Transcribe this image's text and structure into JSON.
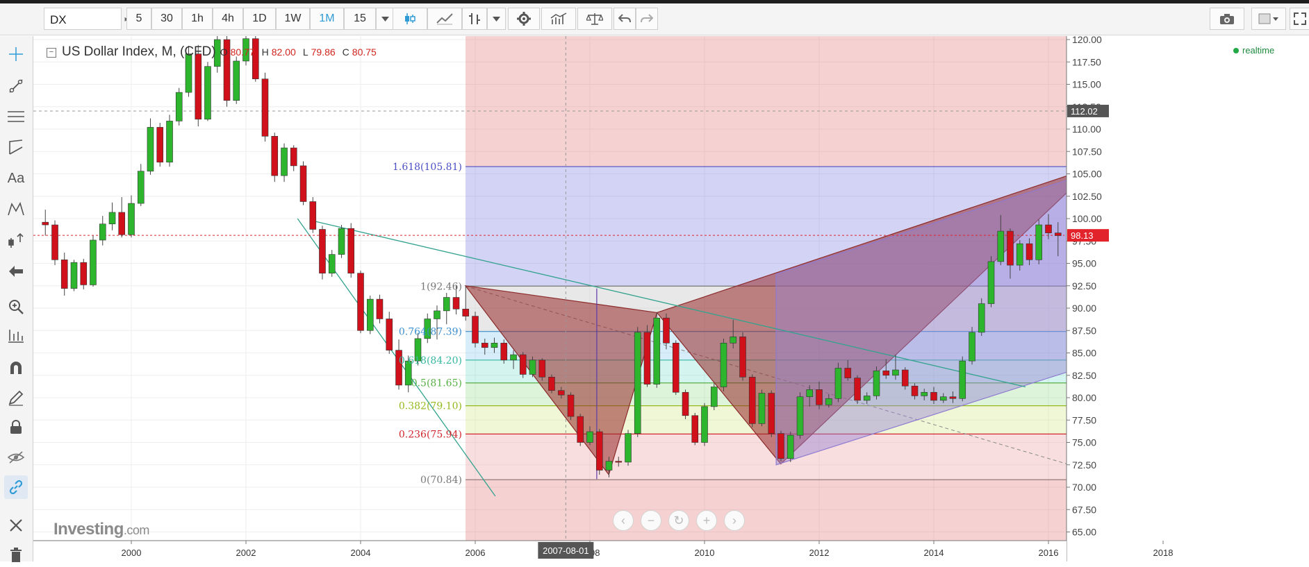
{
  "toolbar": {
    "symbol": "DX",
    "intervals": [
      "5",
      "30",
      "1h",
      "4h",
      "1D",
      "1W",
      "1M",
      "15"
    ],
    "active_interval": "1M"
  },
  "legend": {
    "title": "US Dollar Index, M, (CFD)",
    "o_label": "O",
    "o": "80.77",
    "h_label": "H",
    "h": "82.00",
    "l_label": "L",
    "l": "79.86",
    "c_label": "C",
    "c": "80.75"
  },
  "status": {
    "realtime": "realtime"
  },
  "watermark": {
    "brand": "Investing",
    "tld": ".com"
  },
  "crosshair_date": "2007-08-01",
  "colors": {
    "up": "#2db52d",
    "down": "#d0101a",
    "fib_618": "#4b4fc4",
    "fib_1": "#777777",
    "fib_764": "#3b8fd0",
    "fib_0618": "#35b7a0",
    "fib_05": "#56b045",
    "fib_0382": "#93b91d",
    "fib_0236": "#d0252c",
    "fib_0": "#8a6f6f"
  },
  "chart_data": {
    "type": "candlestick",
    "symbol": "US Dollar Index",
    "interval": "M",
    "x_ticks": [
      "2000",
      "2002",
      "2004",
      "2006",
      "2008",
      "2010",
      "2012",
      "2014",
      "2016",
      "2018"
    ],
    "y_ticks": [
      "120.00",
      "117.50",
      "115.00",
      "112.50",
      "110.00",
      "107.50",
      "105.00",
      "102.50",
      "100.00",
      "97.50",
      "95.00",
      "92.50",
      "90.00",
      "87.50",
      "85.00",
      "82.50",
      "80.00",
      "77.50",
      "75.00",
      "72.50",
      "70.00",
      "67.50",
      "65.00"
    ],
    "ylim": [
      64.5,
      120.8
    ],
    "xlim": [
      1998.3,
      2020.7
    ],
    "last_price": "98.13",
    "crosshair_price": "112.02",
    "fib_levels": [
      {
        "label": "1.618(105.81)",
        "value": 105.81
      },
      {
        "label": "1(92.46)",
        "value": 92.46
      },
      {
        "label": "0.764(87.39)",
        "value": 87.39
      },
      {
        "label": "0.618(84.20)",
        "value": 84.2
      },
      {
        "label": "0.5(81.65)",
        "value": 81.65
      },
      {
        "label": "0.382(79.10)",
        "value": 79.1
      },
      {
        "label": "0.236(75.94)",
        "value": 75.94
      },
      {
        "label": "0(70.84)",
        "value": 70.84
      }
    ],
    "candles": [
      {
        "t": 1998.5,
        "o": 99.6,
        "h": 101,
        "l": 98.1,
        "c": 99.3
      },
      {
        "t": 1998.667,
        "o": 99.3,
        "h": 99.8,
        "l": 94.8,
        "c": 95.4
      },
      {
        "t": 1998.833,
        "o": 95.4,
        "h": 96.2,
        "l": 91.4,
        "c": 92.2
      },
      {
        "t": 1999.0,
        "o": 92.2,
        "h": 95.4,
        "l": 91.9,
        "c": 95.1
      },
      {
        "t": 1999.167,
        "o": 95.1,
        "h": 95.5,
        "l": 92.1,
        "c": 92.6
      },
      {
        "t": 1999.333,
        "o": 92.6,
        "h": 98.1,
        "l": 92.4,
        "c": 97.6
      },
      {
        "t": 1999.5,
        "o": 97.6,
        "h": 100.3,
        "l": 97,
        "c": 99.4
      },
      {
        "t": 1999.667,
        "o": 99.4,
        "h": 101.8,
        "l": 98.7,
        "c": 100.7
      },
      {
        "t": 1999.833,
        "o": 100.7,
        "h": 102.4,
        "l": 97.9,
        "c": 98.2
      },
      {
        "t": 2000.0,
        "o": 98.2,
        "h": 102.6,
        "l": 97.9,
        "c": 101.7
      },
      {
        "t": 2000.167,
        "o": 101.7,
        "h": 106.1,
        "l": 101.4,
        "c": 105.3
      },
      {
        "t": 2000.333,
        "o": 105.3,
        "h": 111.2,
        "l": 104.9,
        "c": 110.2
      },
      {
        "t": 2000.5,
        "o": 110.2,
        "h": 110.7,
        "l": 105.8,
        "c": 106.3
      },
      {
        "t": 2000.667,
        "o": 106.3,
        "h": 111.6,
        "l": 105.8,
        "c": 110.9
      },
      {
        "t": 2000.833,
        "o": 110.9,
        "h": 114.6,
        "l": 110.4,
        "c": 114.1
      },
      {
        "t": 2001.0,
        "o": 114.1,
        "h": 119.3,
        "l": 113.6,
        "c": 118.4
      },
      {
        "t": 2001.167,
        "o": 118.4,
        "h": 119.4,
        "l": 110.3,
        "c": 111.1
      },
      {
        "t": 2001.333,
        "o": 111.1,
        "h": 117.5,
        "l": 110.9,
        "c": 117
      },
      {
        "t": 2001.5,
        "o": 117,
        "h": 120.6,
        "l": 116.3,
        "c": 120
      },
      {
        "t": 2001.667,
        "o": 120,
        "h": 120.5,
        "l": 112.5,
        "c": 113.2
      },
      {
        "t": 2001.833,
        "o": 113.2,
        "h": 118.1,
        "l": 112.8,
        "c": 117.6
      },
      {
        "t": 2002.0,
        "o": 117.6,
        "h": 120.8,
        "l": 117.1,
        "c": 120.1
      },
      {
        "t": 2002.167,
        "o": 120.1,
        "h": 120.5,
        "l": 115.3,
        "c": 115.6
      },
      {
        "t": 2002.333,
        "o": 115.6,
        "h": 116.3,
        "l": 108.6,
        "c": 109.2
      },
      {
        "t": 2002.5,
        "o": 109.2,
        "h": 109.6,
        "l": 104.1,
        "c": 104.8
      },
      {
        "t": 2002.667,
        "o": 104.8,
        "h": 108.4,
        "l": 104.1,
        "c": 107.9
      },
      {
        "t": 2002.833,
        "o": 107.9,
        "h": 108.2,
        "l": 105.3,
        "c": 105.9
      },
      {
        "t": 2003.0,
        "o": 105.9,
        "h": 106.4,
        "l": 101.5,
        "c": 101.9
      },
      {
        "t": 2003.167,
        "o": 101.9,
        "h": 102.4,
        "l": 98.4,
        "c": 98.8
      },
      {
        "t": 2003.333,
        "o": 98.8,
        "h": 99.2,
        "l": 93.2,
        "c": 93.9
      },
      {
        "t": 2003.5,
        "o": 93.9,
        "h": 96.5,
        "l": 93.5,
        "c": 96
      },
      {
        "t": 2003.667,
        "o": 96,
        "h": 99.3,
        "l": 95.6,
        "c": 98.9
      },
      {
        "t": 2003.833,
        "o": 98.9,
        "h": 99.5,
        "l": 93.4,
        "c": 93.9
      },
      {
        "t": 2004.0,
        "o": 93.9,
        "h": 94.2,
        "l": 87.2,
        "c": 87.5
      },
      {
        "t": 2004.167,
        "o": 87.5,
        "h": 91.4,
        "l": 87.1,
        "c": 91
      },
      {
        "t": 2004.333,
        "o": 91,
        "h": 91.5,
        "l": 88.3,
        "c": 88.8
      },
      {
        "t": 2004.5,
        "o": 88.8,
        "h": 89.6,
        "l": 84.9,
        "c": 85.3
      },
      {
        "t": 2004.667,
        "o": 85.3,
        "h": 86.5,
        "l": 80.9,
        "c": 81.4
      },
      {
        "t": 2004.833,
        "o": 81.4,
        "h": 84.7,
        "l": 80.6,
        "c": 84.1
      },
      {
        "t": 2005.0,
        "o": 84.1,
        "h": 87.2,
        "l": 83.6,
        "c": 86.6
      },
      {
        "t": 2005.167,
        "o": 86.6,
        "h": 89.4,
        "l": 86.1,
        "c": 88.8
      },
      {
        "t": 2005.333,
        "o": 88.8,
        "h": 90.3,
        "l": 86.5,
        "c": 89.7
      },
      {
        "t": 2005.5,
        "o": 89.7,
        "h": 91.7,
        "l": 88.2,
        "c": 91.2
      },
      {
        "t": 2005.667,
        "o": 91.2,
        "h": 92.6,
        "l": 89.3,
        "c": 89.9
      },
      {
        "t": 2005.833,
        "o": 89.9,
        "h": 92.5,
        "l": 88.6,
        "c": 89.1
      },
      {
        "t": 2006.0,
        "o": 89.1,
        "h": 89.6,
        "l": 85.6,
        "c": 86.1
      },
      {
        "t": 2006.167,
        "o": 86.1,
        "h": 86.6,
        "l": 84.8,
        "c": 85.6
      },
      {
        "t": 2006.333,
        "o": 85.6,
        "h": 86.7,
        "l": 85,
        "c": 86.1
      },
      {
        "t": 2006.5,
        "o": 86.1,
        "h": 86.5,
        "l": 83.8,
        "c": 84.2
      },
      {
        "t": 2006.667,
        "o": 84.2,
        "h": 85.3,
        "l": 83.2,
        "c": 84.8
      },
      {
        "t": 2006.833,
        "o": 84.8,
        "h": 85.1,
        "l": 82.2,
        "c": 82.6
      },
      {
        "t": 2007.0,
        "o": 82.6,
        "h": 84.6,
        "l": 82.3,
        "c": 84.2
      },
      {
        "t": 2007.167,
        "o": 84.2,
        "h": 84.4,
        "l": 81.9,
        "c": 82.3
      },
      {
        "t": 2007.333,
        "o": 82.3,
        "h": 82.6,
        "l": 80.5,
        "c": 80.8
      },
      {
        "t": 2007.5,
        "o": 80.8,
        "h": 81.2,
        "l": 79.9,
        "c": 80.3
      },
      {
        "t": 2007.667,
        "o": 80.3,
        "h": 80.6,
        "l": 77.5,
        "c": 77.9
      },
      {
        "t": 2007.833,
        "o": 77.9,
        "h": 78.2,
        "l": 74.6,
        "c": 75
      },
      {
        "t": 2008.0,
        "o": 75,
        "h": 76.8,
        "l": 74.7,
        "c": 76.2
      },
      {
        "t": 2008.167,
        "o": 76.2,
        "h": 76.5,
        "l": 71.4,
        "c": 71.9
      },
      {
        "t": 2008.333,
        "o": 71.9,
        "h": 73.4,
        "l": 71.1,
        "c": 72.9
      },
      {
        "t": 2008.5,
        "o": 72.9,
        "h": 73.4,
        "l": 72.3,
        "c": 72.8
      },
      {
        "t": 2008.667,
        "o": 72.8,
        "h": 76.4,
        "l": 72.4,
        "c": 76
      },
      {
        "t": 2008.833,
        "o": 76,
        "h": 87.9,
        "l": 75.6,
        "c": 87.3
      },
      {
        "t": 2009.0,
        "o": 87.3,
        "h": 88.1,
        "l": 81.2,
        "c": 81.5
      },
      {
        "t": 2009.167,
        "o": 81.5,
        "h": 89.5,
        "l": 81.1,
        "c": 88.9
      },
      {
        "t": 2009.333,
        "o": 88.9,
        "h": 89.4,
        "l": 85.4,
        "c": 86.1
      },
      {
        "t": 2009.5,
        "o": 86.1,
        "h": 86.4,
        "l": 80.3,
        "c": 80.6
      },
      {
        "t": 2009.667,
        "o": 80.6,
        "h": 80.9,
        "l": 77.6,
        "c": 78
      },
      {
        "t": 2009.833,
        "o": 78,
        "h": 78.3,
        "l": 74.7,
        "c": 75
      },
      {
        "t": 2010.0,
        "o": 75,
        "h": 79.4,
        "l": 74.6,
        "c": 79
      },
      {
        "t": 2010.167,
        "o": 79,
        "h": 81.6,
        "l": 78.6,
        "c": 81.2
      },
      {
        "t": 2010.333,
        "o": 81.2,
        "h": 86.6,
        "l": 80.7,
        "c": 86.1
      },
      {
        "t": 2010.5,
        "o": 86.1,
        "h": 88.7,
        "l": 85.5,
        "c": 86.8
      },
      {
        "t": 2010.667,
        "o": 86.8,
        "h": 87.3,
        "l": 81.9,
        "c": 82.3
      },
      {
        "t": 2010.833,
        "o": 82.3,
        "h": 82.6,
        "l": 76.7,
        "c": 77.1
      },
      {
        "t": 2011.0,
        "o": 77.1,
        "h": 80.9,
        "l": 76.8,
        "c": 80.5
      },
      {
        "t": 2011.167,
        "o": 80.5,
        "h": 80.8,
        "l": 75.6,
        "c": 76
      },
      {
        "t": 2011.333,
        "o": 76,
        "h": 76.3,
        "l": 72.9,
        "c": 73.2
      },
      {
        "t": 2011.5,
        "o": 73.2,
        "h": 76.2,
        "l": 72.8,
        "c": 75.8
      },
      {
        "t": 2011.667,
        "o": 75.8,
        "h": 80.6,
        "l": 75.4,
        "c": 80.1
      },
      {
        "t": 2011.833,
        "o": 80.1,
        "h": 81.4,
        "l": 79,
        "c": 80.9
      },
      {
        "t": 2012.0,
        "o": 80.9,
        "h": 81.8,
        "l": 78.7,
        "c": 79.2
      },
      {
        "t": 2012.167,
        "o": 79.2,
        "h": 80.4,
        "l": 78.9,
        "c": 79.9
      },
      {
        "t": 2012.333,
        "o": 79.9,
        "h": 83.9,
        "l": 79.5,
        "c": 83.3
      },
      {
        "t": 2012.5,
        "o": 83.3,
        "h": 84.2,
        "l": 81.9,
        "c": 82.2
      },
      {
        "t": 2012.667,
        "o": 82.2,
        "h": 82.5,
        "l": 79.3,
        "c": 79.7
      },
      {
        "t": 2012.833,
        "o": 79.7,
        "h": 80.6,
        "l": 79.3,
        "c": 80.2
      },
      {
        "t": 2013.0,
        "o": 80.2,
        "h": 83.5,
        "l": 79.8,
        "c": 83
      },
      {
        "t": 2013.167,
        "o": 83,
        "h": 84.3,
        "l": 82.1,
        "c": 82.5
      },
      {
        "t": 2013.333,
        "o": 82.5,
        "h": 84.8,
        "l": 82,
        "c": 83.1
      },
      {
        "t": 2013.5,
        "o": 83.1,
        "h": 83.4,
        "l": 80.9,
        "c": 81.3
      },
      {
        "t": 2013.667,
        "o": 81.3,
        "h": 81.6,
        "l": 79.8,
        "c": 80.2
      },
      {
        "t": 2013.833,
        "o": 80.2,
        "h": 81,
        "l": 79.7,
        "c": 80.6
      },
      {
        "t": 2014.0,
        "o": 80.6,
        "h": 81.2,
        "l": 79.3,
        "c": 79.7
      },
      {
        "t": 2014.167,
        "o": 79.7,
        "h": 80.5,
        "l": 79.4,
        "c": 80.1
      },
      {
        "t": 2014.333,
        "o": 80.1,
        "h": 80.7,
        "l": 79.4,
        "c": 79.9
      },
      {
        "t": 2014.5,
        "o": 79.9,
        "h": 84.6,
        "l": 79.6,
        "c": 84.1
      },
      {
        "t": 2014.667,
        "o": 84.1,
        "h": 87.9,
        "l": 83.7,
        "c": 87.3
      },
      {
        "t": 2014.833,
        "o": 87.3,
        "h": 91.1,
        "l": 86.9,
        "c": 90.5
      },
      {
        "t": 2015.0,
        "o": 90.5,
        "h": 95.8,
        "l": 90.1,
        "c": 95.2
      },
      {
        "t": 2015.167,
        "o": 95.2,
        "h": 100.4,
        "l": 94.8,
        "c": 98.6
      },
      {
        "t": 2015.333,
        "o": 98.6,
        "h": 98.9,
        "l": 93.3,
        "c": 94.8
      },
      {
        "t": 2015.5,
        "o": 94.8,
        "h": 97.6,
        "l": 94.2,
        "c": 97.2
      },
      {
        "t": 2015.667,
        "o": 97.2,
        "h": 97.8,
        "l": 94.8,
        "c": 95.4
      },
      {
        "t": 2015.833,
        "o": 95.4,
        "h": 99.9,
        "l": 94.9,
        "c": 99.3
      },
      {
        "t": 2016.0,
        "o": 99.3,
        "h": 100.5,
        "l": 97.7,
        "c": 98.4
      },
      {
        "t": 2016.167,
        "o": 98.4,
        "h": 99.6,
        "l": 95.8,
        "c": 98.1
      }
    ]
  }
}
